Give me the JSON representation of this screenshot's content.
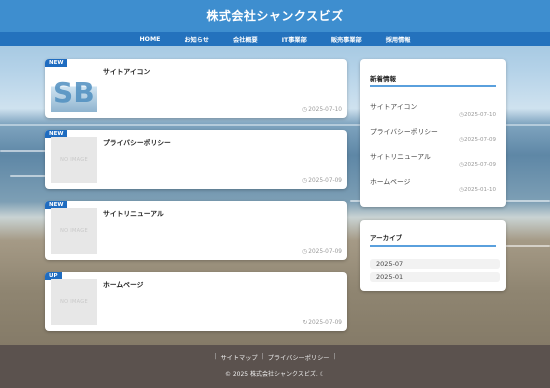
{
  "site": {
    "title": "株式会社シャンクスビズ"
  },
  "nav": [
    {
      "label": "HOME"
    },
    {
      "label": "お知らせ"
    },
    {
      "label": "会社概要"
    },
    {
      "label": "IT事業部"
    },
    {
      "label": "販売事業部"
    },
    {
      "label": "採用情報"
    }
  ],
  "posts": [
    {
      "badge": "NEW",
      "title": "サイトアイコン",
      "thumb": "SB",
      "date": "2025-07-10",
      "date_icon": "clock-icon"
    },
    {
      "badge": "NEW",
      "title": "プライバシーポリシー",
      "thumb": "NO IMAGE",
      "date": "2025-07-09",
      "date_icon": "clock-icon"
    },
    {
      "badge": "NEW",
      "title": "サイトリニューアル",
      "thumb": "NO IMAGE",
      "date": "2025-07-09",
      "date_icon": "clock-icon"
    },
    {
      "badge": "UP",
      "title": "ホームページ",
      "thumb": "NO IMAGE",
      "date": "2025-07-09",
      "date_icon": "refresh-icon"
    }
  ],
  "sidebar": {
    "news": {
      "title": "新着情報",
      "items": [
        {
          "title": "サイトアイコン",
          "date": "2025-07-10"
        },
        {
          "title": "プライバシーポリシー",
          "date": "2025-07-09"
        },
        {
          "title": "サイトリニューアル",
          "date": "2025-07-09"
        },
        {
          "title": "ホームページ",
          "date": "2025-01-10"
        }
      ]
    },
    "archive": {
      "title": "アーカイブ",
      "items": [
        {
          "label": "2025-07"
        },
        {
          "label": "2025-01"
        }
      ]
    }
  },
  "footer": {
    "links": [
      {
        "label": "サイトマップ"
      },
      {
        "label": "プライバシーポリシー"
      }
    ],
    "separator": "|",
    "copyright": "© 2025 株式会社シャンクスビズ."
  },
  "colors": {
    "header": "#3e8ecf",
    "nav": "#2472bd",
    "badge": "#1f6cc0",
    "footer": "#5b524e",
    "accent_line": "#5aa0dd"
  }
}
